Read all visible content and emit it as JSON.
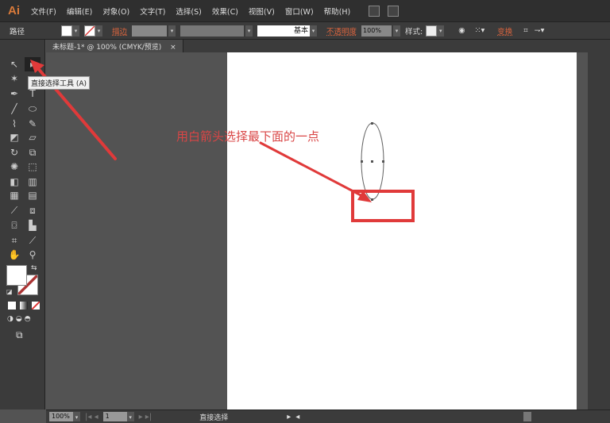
{
  "app": {
    "logo": "Ai"
  },
  "menu": [
    "文件(F)",
    "编辑(E)",
    "对象(O)",
    "文字(T)",
    "选择(S)",
    "效果(C)",
    "视图(V)",
    "窗口(W)",
    "帮助(H)"
  ],
  "control": {
    "object_type": "路径",
    "stroke_label": "描边",
    "stroke_style": "基本",
    "opacity_label": "不透明度",
    "opacity": "100%",
    "style_label": "样式:",
    "transform_label": "变换"
  },
  "tab": {
    "title": "未标题-1* @ 100% (CMYK/预览)",
    "close": "×"
  },
  "tooltip": "直接选择工具 (A)",
  "annotation": {
    "text": "用白箭头选择最下面的一点",
    "color": "#d94646"
  },
  "status": {
    "zoom": "100%",
    "page": "1",
    "tool": "直接选择"
  }
}
